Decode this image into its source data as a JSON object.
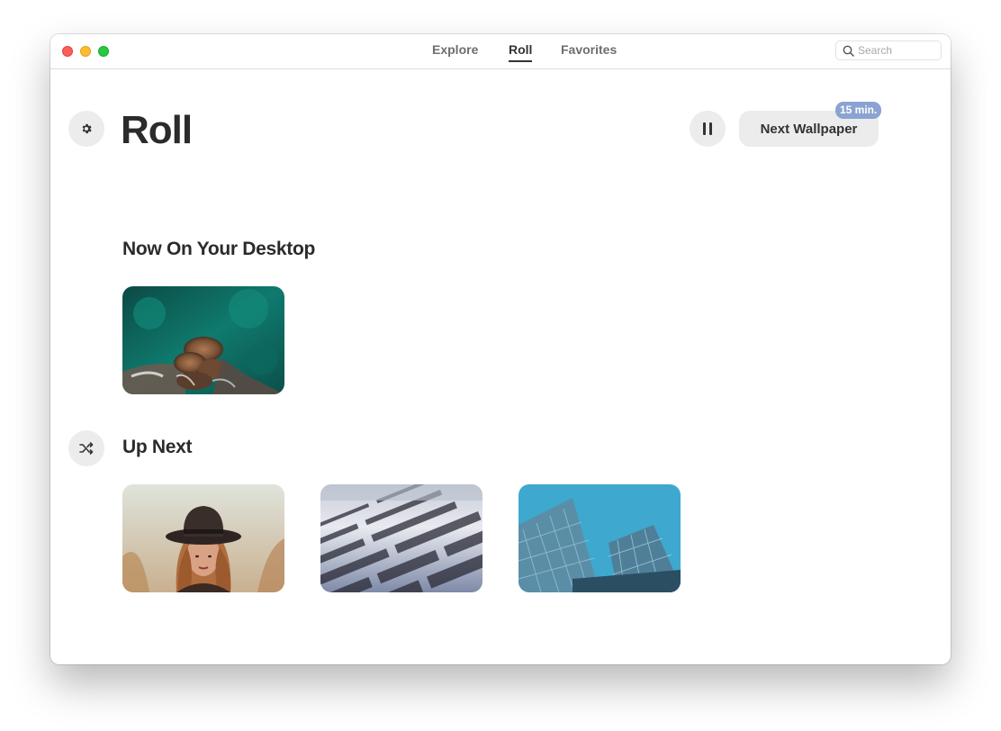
{
  "window": {
    "tabs": [
      {
        "label": "Explore",
        "active": false
      },
      {
        "label": "Roll",
        "active": true
      },
      {
        "label": "Favorites",
        "active": false
      }
    ],
    "search": {
      "placeholder": "Search",
      "value": ""
    }
  },
  "header": {
    "title": "Roll",
    "next_wallpaper_label": "Next Wallpaper",
    "timer_badge": "15 min.",
    "settings_icon": "gear-icon",
    "pause_icon": "pause-icon"
  },
  "now": {
    "title": "Now On Your Desktop",
    "wallpaper": {
      "subject": "aerial ocean rocks"
    }
  },
  "up_next": {
    "title": "Up Next",
    "shuffle_icon": "shuffle-icon",
    "wallpapers": [
      {
        "subject": "woman in black hat"
      },
      {
        "subject": "book text close-up"
      },
      {
        "subject": "glass skyscrapers"
      }
    ]
  },
  "colors": {
    "accent_badge": "#8aa3d2",
    "button_bg": "#ececec",
    "text_dark": "#2b2b2b"
  }
}
